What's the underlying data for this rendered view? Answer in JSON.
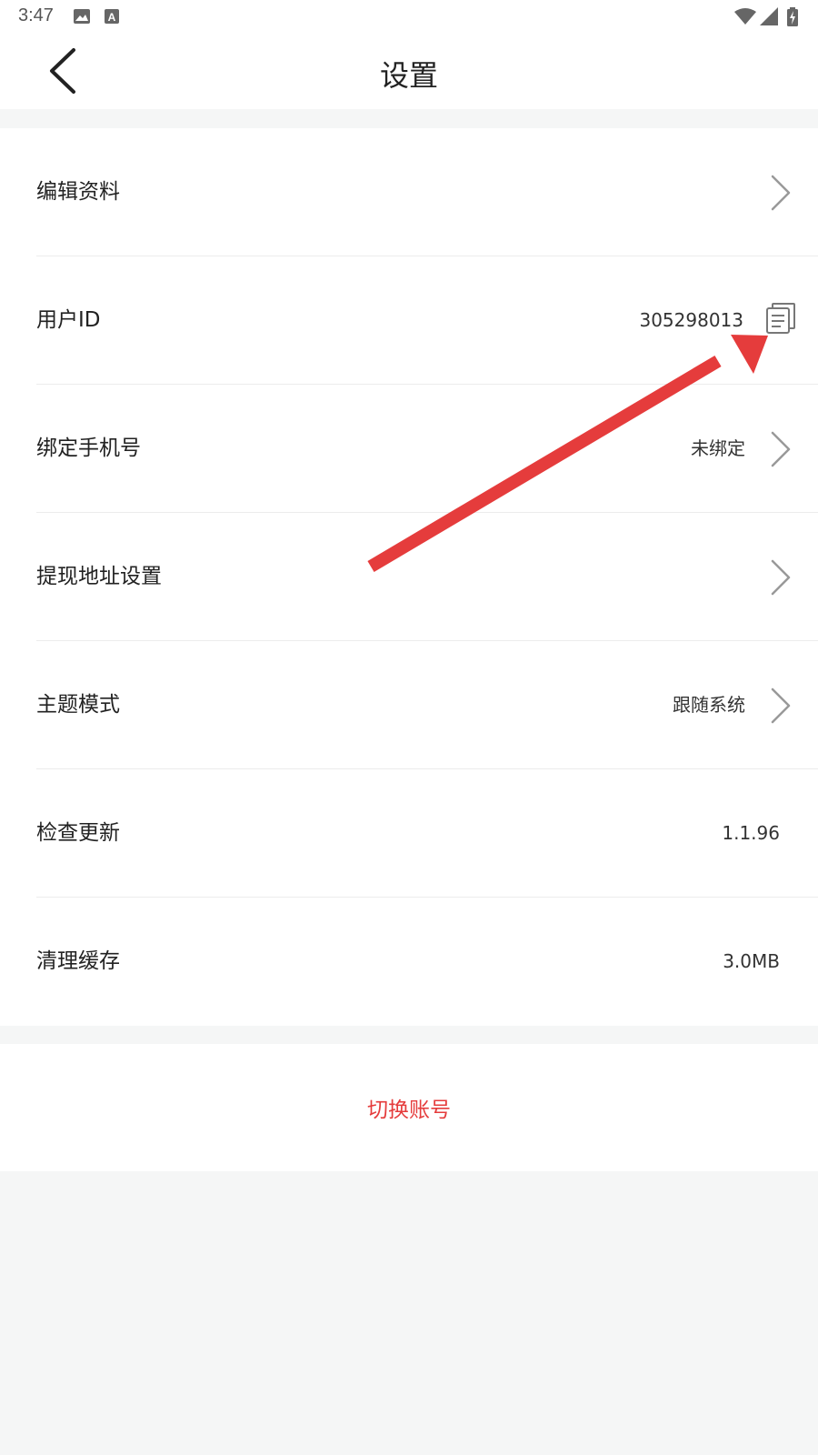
{
  "status_bar": {
    "time": "3:47",
    "icons": [
      "image-icon",
      "a-badge-icon",
      "wifi-icon",
      "signal-icon",
      "battery-charging-icon"
    ]
  },
  "header": {
    "title": "设置",
    "back_icon": "chevron-left-icon"
  },
  "settings": {
    "edit_profile": {
      "label": "编辑资料"
    },
    "user_id": {
      "label": "用户ID",
      "value": "305298013",
      "action_icon": "copy-icon"
    },
    "bind_phone": {
      "label": "绑定手机号",
      "value": "未绑定"
    },
    "withdraw_address": {
      "label": "提现地址设置"
    },
    "theme_mode": {
      "label": "主题模式",
      "value": "跟随系统"
    },
    "check_update": {
      "label": "检查更新",
      "value": "1.1.96"
    },
    "clear_cache": {
      "label": "清理缓存",
      "value": "3.0MB"
    }
  },
  "switch_account": {
    "label": "切换账号"
  },
  "colors": {
    "accent_red": "#e53c3c",
    "annotation_arrow": "#e53c3c",
    "background": "#f5f6f6",
    "surface": "#ffffff"
  }
}
